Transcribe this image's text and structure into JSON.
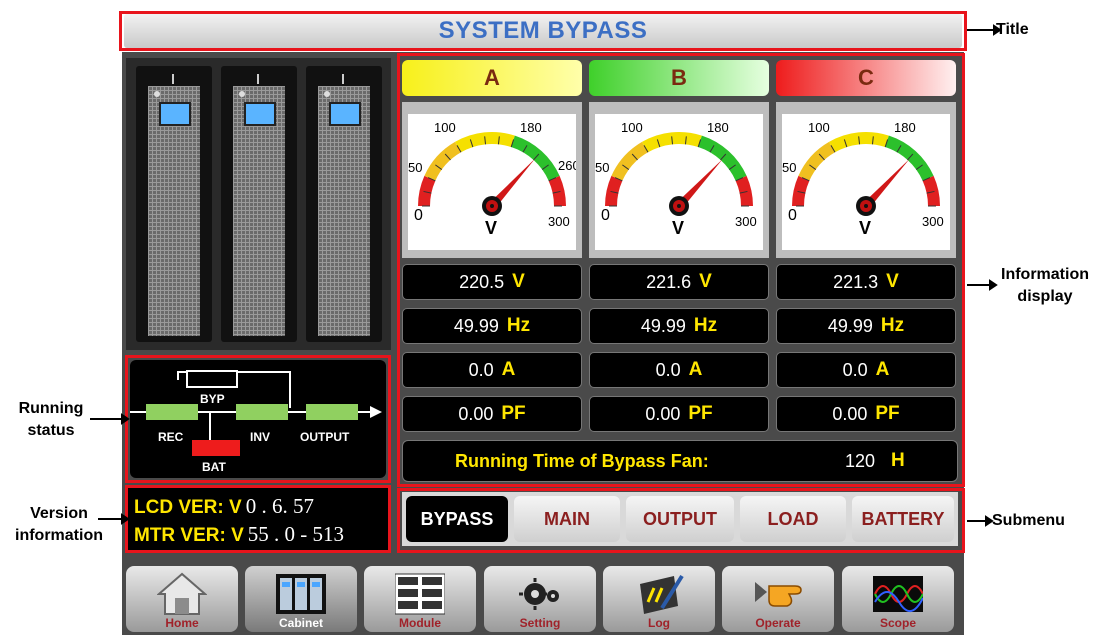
{
  "title": "SYSTEM BYPASS",
  "annotations": {
    "title": "Title",
    "information_display": "Information\ndisplay",
    "running_status": "Running\nstatus",
    "version_information": "Version\ninformation",
    "submenu": "Submenu"
  },
  "running_status": {
    "bypass": "BYP",
    "rectifier": "REC",
    "inverter": "INV",
    "output": "OUTPUT",
    "battery": "BAT"
  },
  "version": {
    "lcd_label": "LCD VER: V",
    "lcd_value": "0 .   6. 57",
    "mtr_label": "MTR VER: V",
    "mtr_value": "55 .  0 - 513"
  },
  "gauge": {
    "scale_labels": [
      "0",
      "50",
      "100",
      "180",
      "260",
      "300"
    ],
    "unit": "V"
  },
  "phases": [
    {
      "name": "A",
      "voltage": "220.5",
      "frequency": "49.99",
      "current": "0.0",
      "pf": "0.00",
      "color_from": "#f7f01a",
      "color_to": "#ffffaa"
    },
    {
      "name": "B",
      "voltage": "221.6",
      "frequency": "49.99",
      "current": "0.0",
      "pf": "0.00",
      "color_from": "#3fd02a",
      "color_to": "#e6ffe0"
    },
    {
      "name": "C",
      "voltage": "221.3",
      "frequency": "49.99",
      "current": "0.0",
      "pf": "0.00",
      "color_from": "#ee1c1c",
      "color_to": "#fff0f0"
    }
  ],
  "units": {
    "voltage": "V",
    "frequency": "Hz",
    "current": "A",
    "pf": "PF",
    "hours": "H"
  },
  "fan": {
    "label": "Running Time of Bypass Fan:",
    "value": "120"
  },
  "submenu": [
    "BYPASS",
    "MAIN",
    "OUTPUT",
    "LOAD",
    "BATTERY"
  ],
  "nav": [
    {
      "label": "Home",
      "icon": "home-icon"
    },
    {
      "label": "Cabinet",
      "icon": "cabinet-icon"
    },
    {
      "label": "Module",
      "icon": "module-icon"
    },
    {
      "label": "Setting",
      "icon": "gear-icon"
    },
    {
      "label": "Log",
      "icon": "log-icon"
    },
    {
      "label": "Operate",
      "icon": "pointing-hand-icon"
    },
    {
      "label": "Scope",
      "icon": "scope-icon"
    }
  ],
  "colors": {
    "title_text": "#3c6fc4",
    "highlight_box": "#e8141c",
    "unit_text": "#ffe600",
    "nav_label": "#a0222a"
  }
}
